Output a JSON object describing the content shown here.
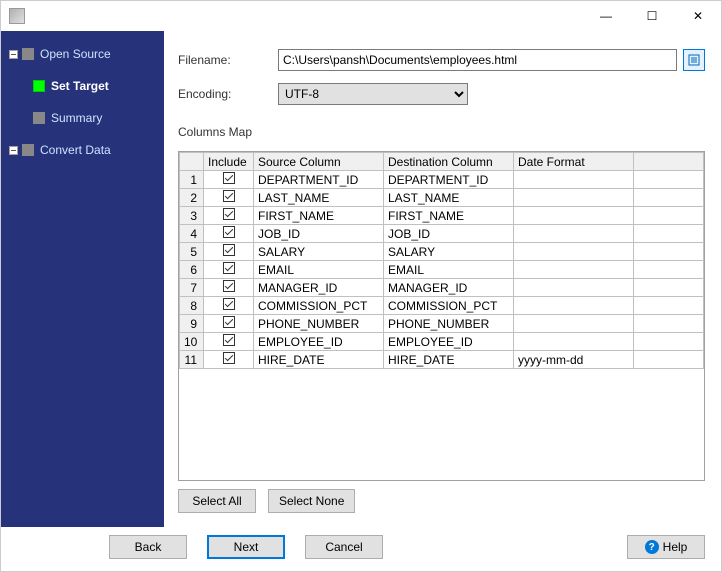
{
  "titlebar": {
    "minimize_glyph": "—",
    "maximize_glyph": "☐",
    "close_glyph": "✕"
  },
  "sidebar": {
    "items": [
      {
        "label": "Open Source",
        "active": false,
        "child": false,
        "expander": true
      },
      {
        "label": "Set Target",
        "active": true,
        "child": true,
        "expander": false
      },
      {
        "label": "Summary",
        "active": false,
        "child": true,
        "expander": false
      },
      {
        "label": "Convert Data",
        "active": false,
        "child": false,
        "expander": true
      }
    ]
  },
  "form": {
    "filename_label": "Filename:",
    "filename_value": "C:\\Users\\pansh\\Documents\\employees.html",
    "encoding_label": "Encoding:",
    "encoding_value": "UTF-8",
    "columns_map_label": "Columns Map"
  },
  "grid": {
    "headers": {
      "include": "Include",
      "source": "Source Column",
      "destination": "Destination Column",
      "date": "Date Format"
    },
    "rows": [
      {
        "n": "1",
        "inc": true,
        "src": "DEPARTMENT_ID",
        "dst": "DEPARTMENT_ID",
        "date": ""
      },
      {
        "n": "2",
        "inc": true,
        "src": "LAST_NAME",
        "dst": "LAST_NAME",
        "date": ""
      },
      {
        "n": "3",
        "inc": true,
        "src": "FIRST_NAME",
        "dst": "FIRST_NAME",
        "date": ""
      },
      {
        "n": "4",
        "inc": true,
        "src": "JOB_ID",
        "dst": "JOB_ID",
        "date": ""
      },
      {
        "n": "5",
        "inc": true,
        "src": "SALARY",
        "dst": "SALARY",
        "date": ""
      },
      {
        "n": "6",
        "inc": true,
        "src": "EMAIL",
        "dst": "EMAIL",
        "date": ""
      },
      {
        "n": "7",
        "inc": true,
        "src": "MANAGER_ID",
        "dst": "MANAGER_ID",
        "date": ""
      },
      {
        "n": "8",
        "inc": true,
        "src": "COMMISSION_PCT",
        "dst": "COMMISSION_PCT",
        "date": ""
      },
      {
        "n": "9",
        "inc": true,
        "src": "PHONE_NUMBER",
        "dst": "PHONE_NUMBER",
        "date": ""
      },
      {
        "n": "10",
        "inc": true,
        "src": "EMPLOYEE_ID",
        "dst": "EMPLOYEE_ID",
        "date": ""
      },
      {
        "n": "11",
        "inc": true,
        "src": "HIRE_DATE",
        "dst": "HIRE_DATE",
        "date": "yyyy-mm-dd"
      }
    ]
  },
  "buttons": {
    "select_all": "Select All",
    "select_none": "Select None",
    "back": "Back",
    "next": "Next",
    "cancel": "Cancel",
    "help": "Help"
  }
}
